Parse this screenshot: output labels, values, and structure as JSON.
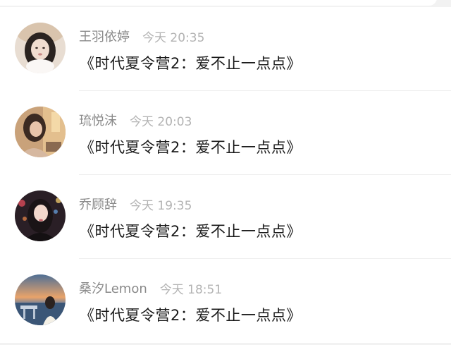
{
  "comments": [
    {
      "name": "王羽依婷",
      "time": "今天 20:35",
      "text": "《时代夏令营2：爱不止一点点》",
      "avatar": "avatar-girl-fur-hat"
    },
    {
      "name": "琉悦沫",
      "time": "今天 20:03",
      "text": "《时代夏令营2：爱不止一点点》",
      "avatar": "avatar-girl-warm-light"
    },
    {
      "name": "乔顾辞",
      "time": "今天 19:35",
      "text": "《时代夏令营2：爱不止一点点》",
      "avatar": "avatar-girl-night-city"
    },
    {
      "name": "桑汐Lemon",
      "time": "今天 18:51",
      "text": "《时代夏令营2：爱不止一点点》",
      "avatar": "avatar-girl-sunset-beach"
    }
  ]
}
